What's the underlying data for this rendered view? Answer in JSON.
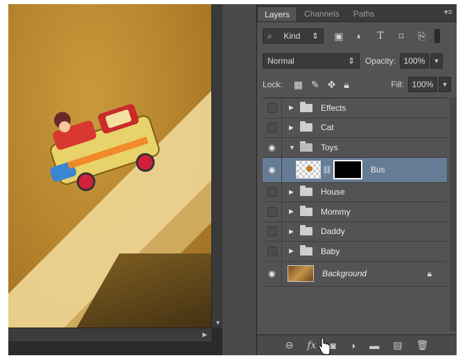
{
  "panel": {
    "tabs": [
      {
        "label": "Layers",
        "active": true
      },
      {
        "label": "Channels",
        "active": false
      },
      {
        "label": "Paths",
        "active": false
      }
    ],
    "filter": {
      "label": "Kind",
      "icons": [
        "image-filter-icon",
        "adjustment-filter-icon",
        "type-filter-icon",
        "shape-filter-icon",
        "smart-object-filter-icon"
      ]
    },
    "blend_mode": "Normal",
    "opacity_label": "Opacity:",
    "opacity_value": "100%",
    "lock_label": "Lock:",
    "fill_label": "Fill:",
    "fill_value": "100%",
    "layers": [
      {
        "name": "Effects",
        "type": "group",
        "visible": false,
        "expanded": false
      },
      {
        "name": "Cat",
        "type": "group",
        "visible": false,
        "expanded": false
      },
      {
        "name": "Toys",
        "type": "group",
        "visible": true,
        "expanded": true
      },
      {
        "name": "Bus",
        "type": "layer",
        "visible": true,
        "selected": true,
        "has_mask": true
      },
      {
        "name": "House",
        "type": "group",
        "visible": false,
        "expanded": false
      },
      {
        "name": "Mommy",
        "type": "group",
        "visible": false,
        "expanded": false
      },
      {
        "name": "Daddy",
        "type": "group",
        "visible": false,
        "expanded": false
      },
      {
        "name": "Baby",
        "type": "group",
        "visible": false,
        "expanded": false
      },
      {
        "name": "Background",
        "type": "background",
        "visible": true,
        "locked": true
      }
    ],
    "bottom_icons": [
      "link-layers-icon",
      "fx-icon",
      "add-mask-icon",
      "adjustment-layer-icon",
      "new-group-icon",
      "new-layer-icon",
      "delete-layer-icon"
    ],
    "fx_label": "fx"
  },
  "colors": {
    "panel_bg": "#535353",
    "selected_layer": "#667b94",
    "canvas_warm": "#b7862e"
  }
}
